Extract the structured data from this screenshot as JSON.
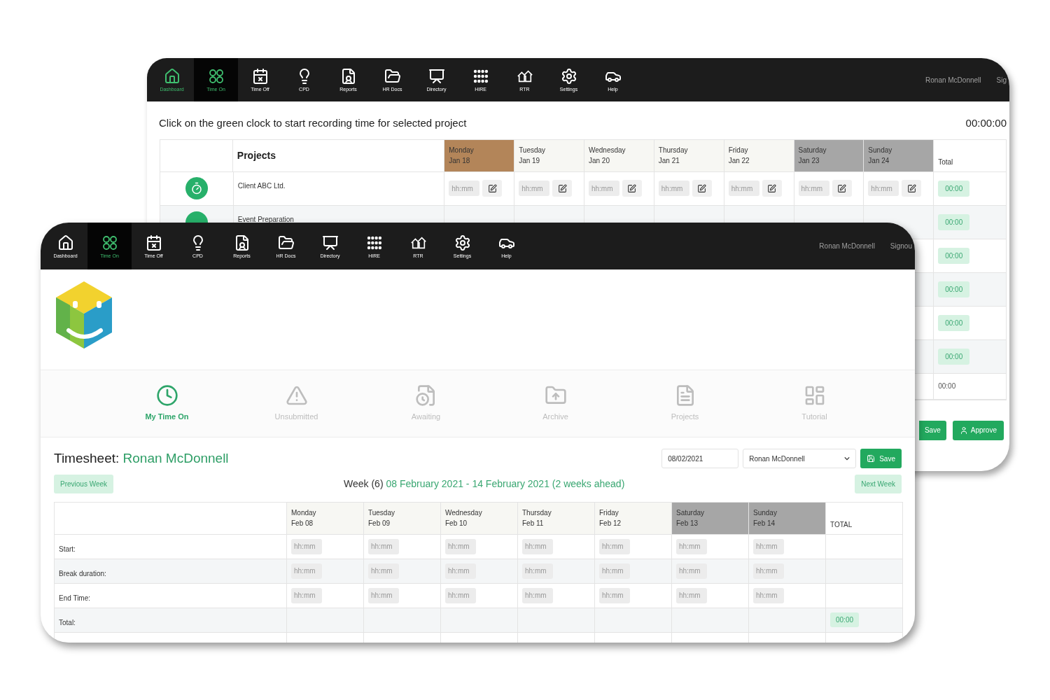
{
  "back_window": {
    "nav": {
      "items": [
        {
          "label": "Dashboard",
          "selected": false,
          "accent": true
        },
        {
          "label": "Time On",
          "selected": true,
          "accent": true
        },
        {
          "label": "Time Off",
          "selected": false,
          "accent": false
        },
        {
          "label": "CPD",
          "selected": false,
          "accent": false
        },
        {
          "label": "Reports",
          "selected": false,
          "accent": false
        },
        {
          "label": "HR Docs",
          "selected": false,
          "accent": false
        },
        {
          "label": "Directory",
          "selected": false,
          "accent": false
        },
        {
          "label": "HIRE",
          "selected": false,
          "accent": false
        },
        {
          "label": "RTR",
          "selected": false,
          "accent": false
        },
        {
          "label": "Settings",
          "selected": false,
          "accent": false
        },
        {
          "label": "Help",
          "selected": false,
          "accent": false
        }
      ],
      "user_name": "Ronan McDonnell",
      "signout": "Sig"
    },
    "instruction": "Click on the green clock to start recording time for selected project",
    "timer": "00:00:00",
    "table": {
      "projects_header": "Projects",
      "total_header": "Total",
      "days": [
        {
          "day": "Monday",
          "date": "Jan 18",
          "kind": "today"
        },
        {
          "day": "Tuesday",
          "date": "Jan 19",
          "kind": "weekday"
        },
        {
          "day": "Wednesday",
          "date": "Jan 20",
          "kind": "weekday"
        },
        {
          "day": "Thursday",
          "date": "Jan 21",
          "kind": "weekday"
        },
        {
          "day": "Friday",
          "date": "Jan 22",
          "kind": "weekday"
        },
        {
          "day": "Saturday",
          "date": "Jan 23",
          "kind": "weekend"
        },
        {
          "day": "Sunday",
          "date": "Jan 24",
          "kind": "weekend"
        }
      ],
      "rows": [
        {
          "kind": "project",
          "project": "Client ABC Ltd.",
          "placeholders": [
            "hh:mm",
            "hh:mm",
            "hh:mm",
            "hh:mm",
            "hh:mm",
            "hh:mm",
            "hh:mm"
          ],
          "total": "00:00"
        },
        {
          "kind": "partial",
          "project": "Event Preparation",
          "total": "00:00"
        },
        {
          "kind": "hidden",
          "total": "00:00"
        },
        {
          "kind": "hidden",
          "total": "00:00"
        },
        {
          "kind": "hidden",
          "total": "00:00"
        },
        {
          "kind": "hidden",
          "total": "00:00"
        },
        {
          "kind": "sum",
          "total": "00:00"
        }
      ]
    },
    "buttons": [
      {
        "label": "Save"
      },
      {
        "label": "Approve"
      }
    ]
  },
  "front_window": {
    "nav": {
      "items": [
        {
          "label": "Dashboard",
          "selected": false,
          "accent": false
        },
        {
          "label": "Time On",
          "selected": true,
          "accent": true
        },
        {
          "label": "Time Off",
          "selected": false,
          "accent": false
        },
        {
          "label": "CPD",
          "selected": false,
          "accent": false
        },
        {
          "label": "Reports",
          "selected": false,
          "accent": false
        },
        {
          "label": "HR Docs",
          "selected": false,
          "accent": false
        },
        {
          "label": "Directory",
          "selected": false,
          "accent": false
        },
        {
          "label": "HIRE",
          "selected": false,
          "accent": false
        },
        {
          "label": "RTR",
          "selected": false,
          "accent": false
        },
        {
          "label": "Settings",
          "selected": false,
          "accent": false
        },
        {
          "label": "Help",
          "selected": false,
          "accent": false
        }
      ],
      "user_name": "Ronan McDonnell",
      "signout": "Signou"
    },
    "tabs": [
      {
        "label": "My Time On",
        "selected": true
      },
      {
        "label": "Unsubmitted",
        "selected": false
      },
      {
        "label": "Awaiting",
        "selected": false
      },
      {
        "label": "Archive",
        "selected": false
      },
      {
        "label": "Projects",
        "selected": false
      },
      {
        "label": "Tutorial",
        "selected": false
      }
    ],
    "timesheet": {
      "title": "Timesheet:",
      "name": "Ronan McDonnell",
      "date": "08/02/2021",
      "person": "Ronan McDonnell",
      "save": "Save",
      "previous_week": "Previous Week",
      "week": "Week (6)",
      "range": "08 February 2021 - 14 February 2021 (2 weeks ahead)",
      "next_week": "Next Week",
      "total_header": "TOTAL",
      "days": [
        {
          "day": "Monday",
          "date": "Feb 08",
          "kind": "weekday"
        },
        {
          "day": "Tuesday",
          "date": "Feb 09",
          "kind": "weekday"
        },
        {
          "day": "Wednesday",
          "date": "Feb 10",
          "kind": "weekday"
        },
        {
          "day": "Thursday",
          "date": "Feb 11",
          "kind": "weekday"
        },
        {
          "day": "Friday",
          "date": "Feb 12",
          "kind": "weekday"
        },
        {
          "day": "Saturday",
          "date": "Feb 13",
          "kind": "weekend"
        },
        {
          "day": "Sunday",
          "date": "Feb 14",
          "kind": "weekend"
        }
      ],
      "rows": [
        {
          "kind": "entry",
          "label": "Start:",
          "placeholders": [
            "hh:mm",
            "hh:mm",
            "hh:mm",
            "hh:mm",
            "hh:mm",
            "hh:mm",
            "hh:mm"
          ]
        },
        {
          "kind": "entry",
          "label": "Break duration:",
          "placeholders": [
            "hh:mm",
            "hh:mm",
            "hh:mm",
            "hh:mm",
            "hh:mm",
            "hh:mm",
            "hh:mm"
          ]
        },
        {
          "kind": "entry",
          "label": "End Time:",
          "placeholders": [
            "hh:mm",
            "hh:mm",
            "hh:mm",
            "hh:mm",
            "hh:mm",
            "hh:mm",
            "hh:mm"
          ]
        },
        {
          "kind": "sum",
          "label": "Total:",
          "total": "00:00"
        }
      ]
    }
  }
}
